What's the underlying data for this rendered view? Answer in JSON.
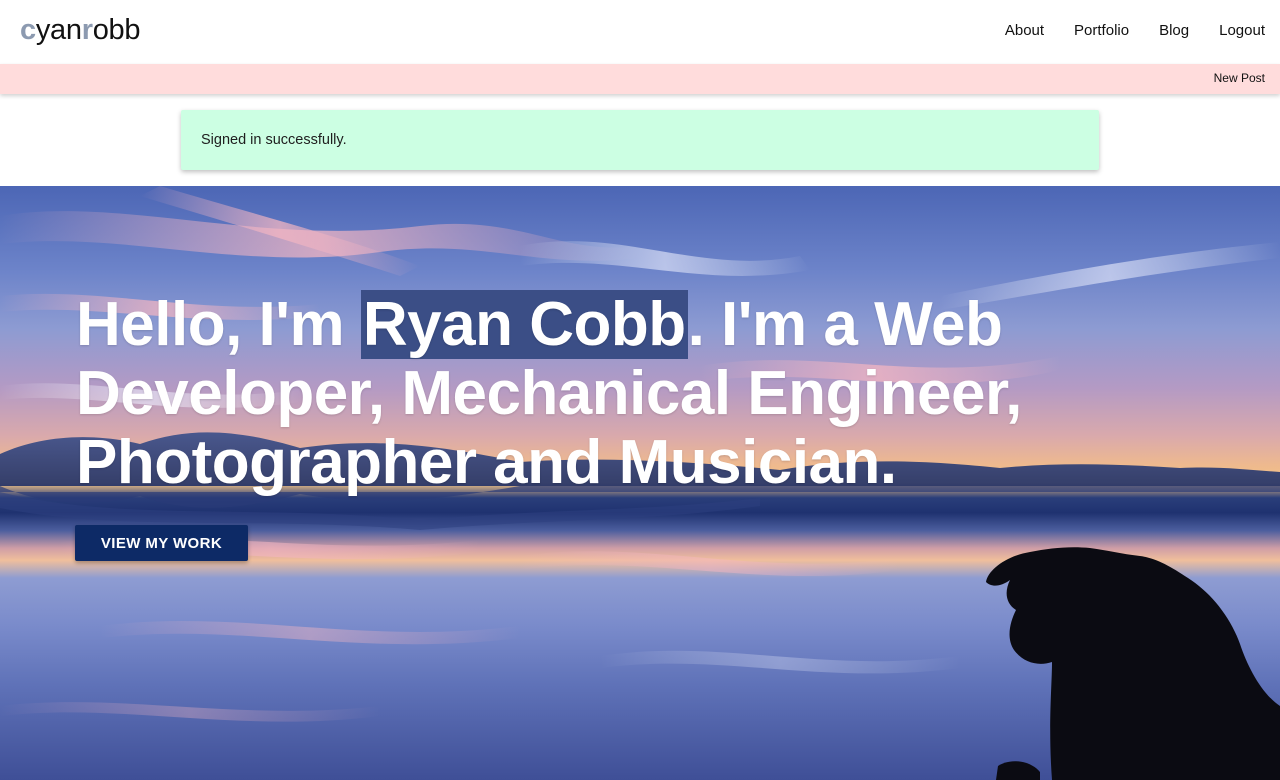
{
  "brand": {
    "c": "c",
    "yan": "yan",
    "r": "r",
    "obb": "obb"
  },
  "nav": {
    "items": [
      "About",
      "Portfolio",
      "Blog",
      "Logout"
    ]
  },
  "subnav": {
    "new_post": "New Post"
  },
  "flash": {
    "message": "Signed in successfully."
  },
  "hero": {
    "line_before": "Hello, I'm ",
    "highlight": "Ryan Cobb",
    "line_after": ". I'm a Web Developer, Mechanical Engineer, Photographer and Musician.",
    "cta_label": "VIEW MY WORK"
  },
  "colors": {
    "brand_accent": "#8c9ab0",
    "subbar": "#ffdcdc",
    "flash_bg": "#ccffe3",
    "cta_bg": "#0d2a66",
    "highlight_bg": "#3b4e86"
  }
}
